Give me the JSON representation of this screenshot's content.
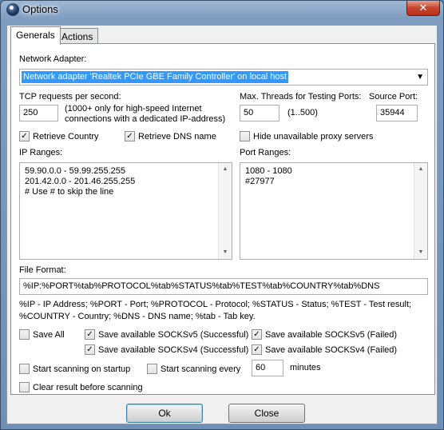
{
  "window": {
    "title": "Options",
    "close_glyph": "✕"
  },
  "tabs": [
    {
      "label": "Generals"
    },
    {
      "label": "Actions"
    }
  ],
  "adapter": {
    "label": "Network Adapter:",
    "value": "Network adapter 'Realtek PCIe GBE Family Controller' on local host"
  },
  "tcp": {
    "label": "TCP requests per second:",
    "value": "250",
    "note_line1": "(1000+ only for high-speed Internet",
    "note_line2": "connections with a dedicated IP-address)"
  },
  "threads": {
    "label": "Max. Threads for Testing Ports:",
    "value": "50",
    "range": "(1..500)"
  },
  "source_port": {
    "label": "Source Port:",
    "value": "35944"
  },
  "checks_row1": {
    "retrieve_country": "Retrieve Country",
    "retrieve_dns": "Retrieve DNS name",
    "hide_unavailable": "Hide unavailable proxy servers"
  },
  "ip_ranges": {
    "label": "IP Ranges:",
    "lines": [
      "59.90.0.0 - 59.99.255.255",
      "201.42.0.0 - 201.46.255.255",
      "# Use # to skip the line"
    ]
  },
  "port_ranges": {
    "label": "Port Ranges:",
    "lines": [
      "1080 - 1080",
      "#27977"
    ]
  },
  "file_format": {
    "label": "File Format:",
    "value": "%IP:%PORT%tab%PROTOCOL%tab%STATUS%tab%TEST%tab%COUNTRY%tab%DNS",
    "legend_line1": "%IP - IP Address; %PORT - Port; %PROTOCOL - Protocol; %STATUS - Status; %TEST - Test result;",
    "legend_line2": "%COUNTRY - Country; %DNS - DNS name; %tab - Tab key."
  },
  "save": {
    "save_all": "Save All",
    "socks5_ok": "Save available SOCKSv5 (Successful)",
    "socks5_fail": "Save available SOCKSv5 (Failed)",
    "socks4_ok": "Save available SOCKSv4 (Successful)",
    "socks4_fail": "Save available SOCKSv4 (Failed)"
  },
  "scan": {
    "start_on_startup": "Start scanning on startup",
    "start_every": "Start scanning every",
    "every_value": "60",
    "minutes": "minutes",
    "clear_before": "Clear result before scanning"
  },
  "buttons": {
    "ok": "Ok",
    "close": "Close"
  },
  "glyphs": {
    "check": "✓",
    "dropdown": "▼",
    "up": "▲",
    "down": "▼"
  }
}
